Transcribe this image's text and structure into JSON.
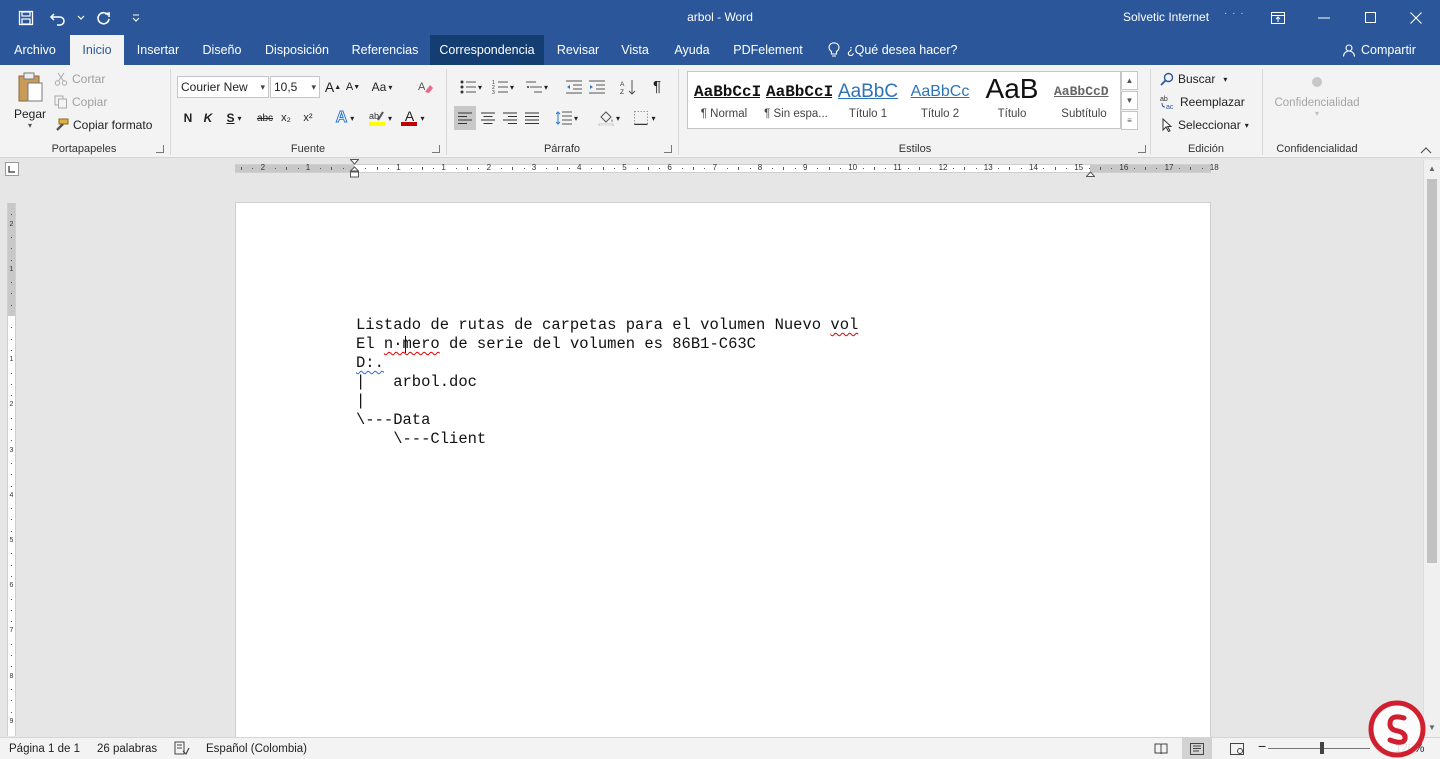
{
  "window": {
    "title": "arbol  -  Word",
    "user": "Solvetic Internet",
    "user_dots": "· · ·"
  },
  "tabs": [
    {
      "label": "Archivo",
      "state": "normal"
    },
    {
      "label": "Inicio",
      "state": "active"
    },
    {
      "label": "Insertar",
      "state": "normal"
    },
    {
      "label": "Diseño",
      "state": "normal"
    },
    {
      "label": "Disposición",
      "state": "normal"
    },
    {
      "label": "Referencias",
      "state": "normal"
    },
    {
      "label": "Correspondencia",
      "state": "highlight"
    },
    {
      "label": "Revisar",
      "state": "normal"
    },
    {
      "label": "Vista",
      "state": "normal"
    },
    {
      "label": "Ayuda",
      "state": "normal"
    },
    {
      "label": "PDFelement",
      "state": "normal"
    }
  ],
  "tell_me": "¿Qué desea hacer?",
  "share": "Compartir",
  "ribbon": {
    "clipboard": {
      "label": "Portapapeles",
      "paste": "Pegar",
      "cut": "Cortar",
      "copy": "Copiar",
      "format_painter": "Copiar formato"
    },
    "font": {
      "label": "Fuente",
      "font_name": "Courier New",
      "font_size": "10,5",
      "bold": "N",
      "italic": "K",
      "underline": "S",
      "strikethrough": "abc",
      "subscript": "x₂",
      "superscript": "x²",
      "change_case": "Aa",
      "grow": "A",
      "shrink": "A",
      "text_effects": "A",
      "font_color": "A"
    },
    "paragraph": {
      "label": "Párrafo",
      "pilcrow": "¶"
    },
    "styles": {
      "label": "Estilos",
      "items": [
        {
          "preview": "AaBbCcI",
          "name": "¶ Normal"
        },
        {
          "preview": "AaBbCcI",
          "name": "¶ Sin espa..."
        },
        {
          "preview": "AaBbC",
          "name": "Título 1"
        },
        {
          "preview": "AaBbCc",
          "name": "Título 2"
        },
        {
          "preview": "AaB",
          "name": "Título"
        },
        {
          "preview": "AaBbCcD",
          "name": "Subtítulo"
        }
      ]
    },
    "editing": {
      "label": "Edición",
      "find": "Buscar",
      "replace": "Reemplazar",
      "select": "Seleccionar"
    },
    "confidentiality": {
      "label": "Confidencialidad",
      "button": "Confidencialidad"
    }
  },
  "ruler": {
    "h_numbers": [
      "2",
      "1",
      "1",
      "1",
      "2",
      "3",
      "4",
      "5",
      "6",
      "7",
      "8",
      "9",
      "10",
      "11",
      "12",
      "13",
      "14",
      "15",
      "16",
      "17",
      "18"
    ],
    "v_numbers": [
      "2",
      "1",
      "1",
      "2",
      "3",
      "4",
      "5",
      "6",
      "7",
      "8",
      "9"
    ]
  },
  "document": {
    "lines": [
      {
        "pre": "Listado de rutas de carpetas para el volumen Nuevo ",
        "squig": "vol",
        "post": ""
      },
      {
        "pre": "El ",
        "squig": "n·mero",
        "post": " de serie del volumen es 86B1-C63C"
      },
      {
        "pre": "",
        "squig_blue": "D:.",
        "post": ""
      },
      {
        "pre": "|   arbol.doc",
        "squig": "",
        "post": ""
      },
      {
        "pre": "|",
        "squig": "",
        "post": ""
      },
      {
        "pre": "\\---Data",
        "squig": "",
        "post": ""
      },
      {
        "pre": "    \\---Client",
        "squig": "",
        "post": ""
      }
    ]
  },
  "status": {
    "page": "Página 1 de 1",
    "words": "26 palabras",
    "language": "Español (Colombia)",
    "zoom": "120%"
  },
  "colors": {
    "word_blue": "#2b579a",
    "highlight_tab": "#143d72",
    "font_color_bar": "#c00000",
    "highlight_bar": "#ffff00"
  }
}
